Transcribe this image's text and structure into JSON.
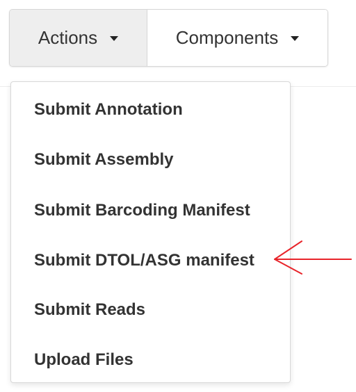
{
  "toolbar": {
    "actions_label": "Actions",
    "components_label": "Components"
  },
  "menu": {
    "items": [
      {
        "label": "Submit Annotation"
      },
      {
        "label": "Submit Assembly"
      },
      {
        "label": "Submit Barcoding Manifest"
      },
      {
        "label": "Submit DTOL/ASG manifest"
      },
      {
        "label": "Submit Reads"
      },
      {
        "label": "Upload Files"
      }
    ]
  },
  "annotation": {
    "arrow_color": "#e8242a",
    "icon": "left-arrow-icon"
  }
}
